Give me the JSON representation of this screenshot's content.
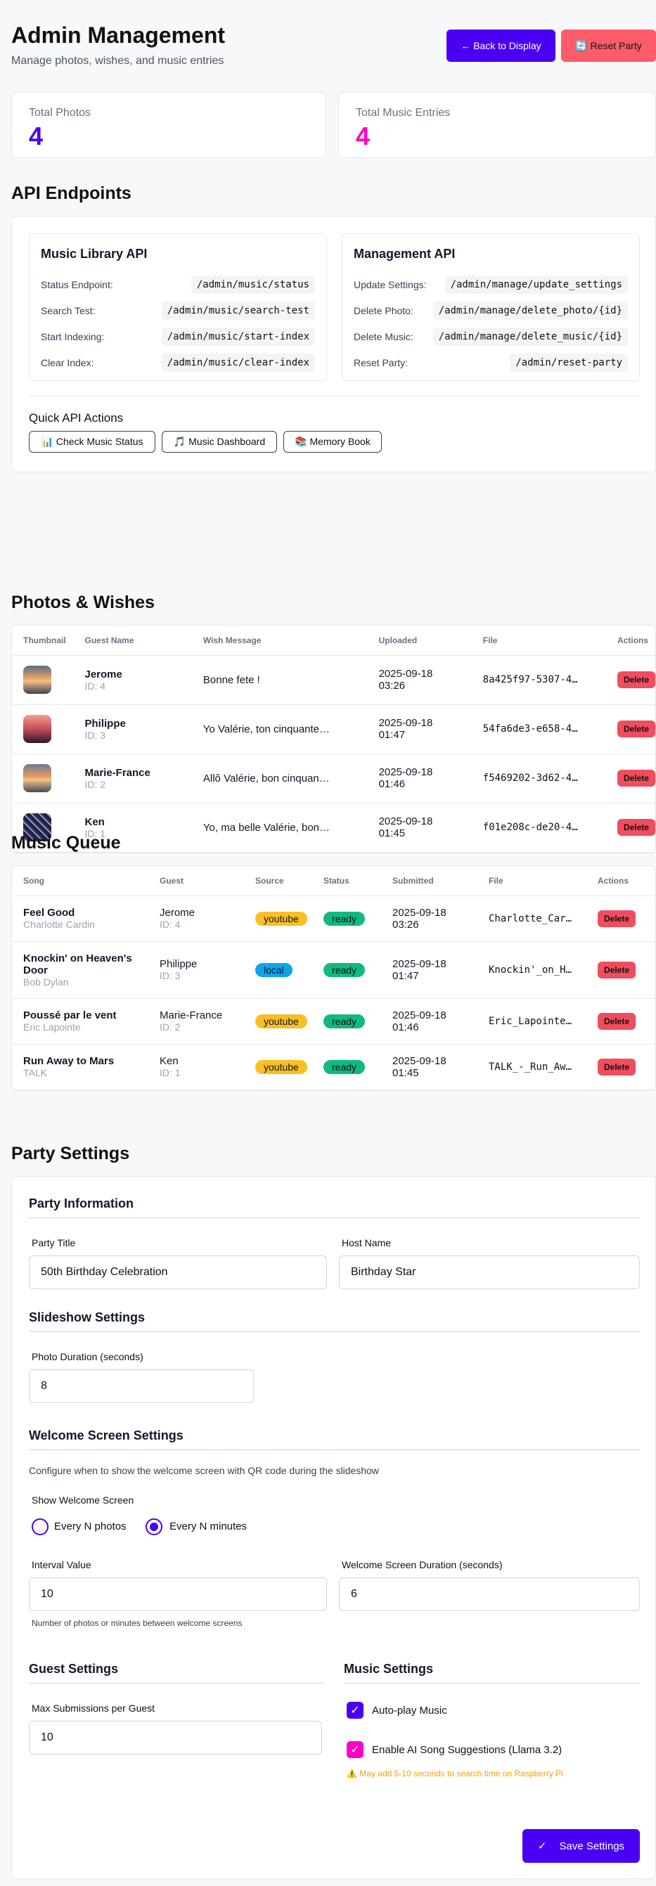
{
  "header": {
    "title": "Admin Management",
    "subtitle": "Manage photos, wishes, and music entries",
    "back_label": "← Back to Display",
    "reset_label": "🔄 Reset Party"
  },
  "stats": {
    "photos_label": "Total Photos",
    "photos_value": "4",
    "music_label": "Total Music Entries",
    "music_value": "4"
  },
  "api": {
    "title": "API Endpoints",
    "music_title": "Music Library API",
    "music_rows": [
      {
        "label": "Status Endpoint:",
        "path": "/admin/music/status"
      },
      {
        "label": "Search Test:",
        "path": "/admin/music/search-test"
      },
      {
        "label": "Start Indexing:",
        "path": "/admin/music/start-index"
      },
      {
        "label": "Clear Index:",
        "path": "/admin/music/clear-index"
      }
    ],
    "mgmt_title": "Management API",
    "mgmt_rows": [
      {
        "label": "Update Settings:",
        "path": "/admin/manage/update_settings"
      },
      {
        "label": "Delete Photo:",
        "path": "/admin/manage/delete_photo/{id}"
      },
      {
        "label": "Delete Music:",
        "path": "/admin/manage/delete_music/{id}"
      },
      {
        "label": "Reset Party:",
        "path": "/admin/reset-party"
      }
    ],
    "quick_title": "Quick API Actions",
    "quick_buttons": [
      "📊 Check Music Status",
      "🎵 Music Dashboard",
      "📚 Memory Book"
    ]
  },
  "photos": {
    "title": "Photos & Wishes",
    "headers": [
      "Thumbnail",
      "Guest Name",
      "Wish Message",
      "Uploaded",
      "File",
      "Actions"
    ],
    "rows": [
      {
        "name": "Jerome",
        "id": "ID: 4",
        "wish": "Bonne fete !",
        "date": "2025-09-18",
        "time": "03:26",
        "file": "8a425f97-5307-4…",
        "action": "Delete"
      },
      {
        "name": "Philippe",
        "id": "ID: 3",
        "wish": "Yo Valérie, ton cinquante…",
        "date": "2025-09-18",
        "time": "01:47",
        "file": "54fa6de3-e658-4…",
        "action": "Delete"
      },
      {
        "name": "Marie-France",
        "id": "ID: 2",
        "wish": "Allô Valérie, bon cinquan…",
        "date": "2025-09-18",
        "time": "01:46",
        "file": "f5469202-3d62-4…",
        "action": "Delete"
      },
      {
        "name": "Ken",
        "id": "ID: 1",
        "wish": "Yo, ma belle Valérie, bon…",
        "date": "2025-09-18",
        "time": "01:45",
        "file": "f01e208c-de20-4…",
        "action": "Delete"
      }
    ]
  },
  "music": {
    "title": "Music Queue",
    "headers": [
      "Song",
      "Guest",
      "Source",
      "Status",
      "Submitted",
      "File",
      "Actions"
    ],
    "rows": [
      {
        "song": "Feel Good",
        "artist": "Charlotte Cardin",
        "guest": "Jerome",
        "gid": "ID: 4",
        "source": "youtube",
        "status": "ready",
        "date": "2025-09-18",
        "time": "03:26",
        "file": "Charlotte_Car…",
        "action": "Delete"
      },
      {
        "song": "Knockin' on Heaven's Door",
        "artist": "Bob Dylan",
        "guest": "Philippe",
        "gid": "ID: 3",
        "source": "local",
        "status": "ready",
        "date": "2025-09-18",
        "time": "01:47",
        "file": "Knockin'_on_H…",
        "action": "Delete"
      },
      {
        "song": "Poussé par le vent",
        "artist": "Eric Lapointe",
        "guest": "Marie-France",
        "gid": "ID: 2",
        "source": "youtube",
        "status": "ready",
        "date": "2025-09-18",
        "time": "01:46",
        "file": "Eric_Lapointe…",
        "action": "Delete"
      },
      {
        "song": "Run Away to Mars",
        "artist": "TALK",
        "guest": "Ken",
        "gid": "ID: 1",
        "source": "youtube",
        "status": "ready",
        "date": "2025-09-18",
        "time": "01:45",
        "file": "TALK_-_Run_Aw…",
        "action": "Delete"
      }
    ]
  },
  "settings": {
    "title": "Party Settings",
    "party_info": "Party Information",
    "party_title_label": "Party Title",
    "party_title_value": "50th Birthday Celebration",
    "host_label": "Host Name",
    "host_value": "Birthday Star",
    "slideshow": "Slideshow Settings",
    "photo_duration_label": "Photo Duration (seconds)",
    "photo_duration_value": "8",
    "welcome": "Welcome Screen Settings",
    "welcome_desc": "Configure when to show the welcome screen with QR code during the slideshow",
    "show_welcome": "Show Welcome Screen",
    "opt_photos": "Every N photos",
    "opt_minutes": "Every N minutes",
    "interval_label": "Interval Value",
    "interval_value": "10",
    "welcome_dur_label": "Welcome Screen Duration (seconds)",
    "welcome_dur_value": "6",
    "interval_help": "Number of photos or minutes between welcome screens",
    "guest": "Guest Settings",
    "max_sub_label": "Max Submissions per Guest",
    "max_sub_value": "10",
    "music": "Music Settings",
    "autoplay": "Auto-play Music",
    "ai": "Enable AI Song Suggestions (Llama 3.2)",
    "ai_warn": "⚠️ May add 5-10 seconds to search time on Raspberry Pi",
    "save": "Save Settings"
  },
  "colors": {
    "accent": "#4a00f2",
    "pink": "#ff00c8",
    "danger": "#f04d5e",
    "youtube": "#fbbf24",
    "local": "#0ea5e9",
    "ready": "#10b981"
  }
}
